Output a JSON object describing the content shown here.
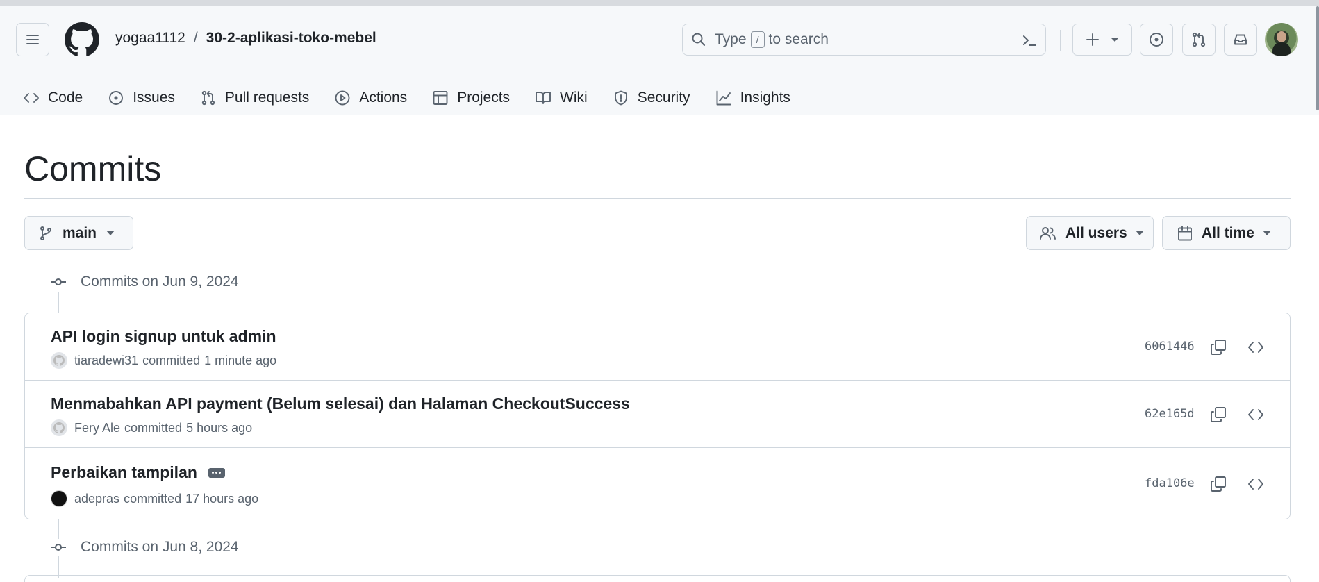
{
  "repo": {
    "owner": "yogaa1112",
    "separator": "/",
    "name": "30-2-aplikasi-toko-mebel"
  },
  "search": {
    "placeholder_prefix": "Type",
    "placeholder_key": "/",
    "placeholder_suffix": "to search"
  },
  "nav_tabs": [
    {
      "label": "Code",
      "icon": "code-icon"
    },
    {
      "label": "Issues",
      "icon": "issue-opened-icon"
    },
    {
      "label": "Pull requests",
      "icon": "git-pull-request-icon"
    },
    {
      "label": "Actions",
      "icon": "play-icon"
    },
    {
      "label": "Projects",
      "icon": "table-icon"
    },
    {
      "label": "Wiki",
      "icon": "book-icon"
    },
    {
      "label": "Security",
      "icon": "shield-icon"
    },
    {
      "label": "Insights",
      "icon": "graph-icon"
    }
  ],
  "page": {
    "title": "Commits"
  },
  "filters": {
    "branch": "main",
    "users": "All users",
    "time": "All time"
  },
  "groups": [
    {
      "heading": "Commits on Jun 9, 2024",
      "commits": [
        {
          "message": "API login signup untuk admin",
          "author": "tiaradewi31",
          "action": "committed",
          "time": "1 minute ago",
          "sha": "6061446",
          "has_ellipsis": false
        },
        {
          "message": "Menmabahkan API payment (Belum selesai) dan Halaman CheckoutSuccess",
          "author": "Fery Ale",
          "action": "committed",
          "time": "5 hours ago",
          "sha": "62e165d",
          "has_ellipsis": false
        },
        {
          "message": "Perbaikan tampilan",
          "author": "adepras",
          "action": "committed",
          "time": "17 hours ago",
          "sha": "fda106e",
          "has_ellipsis": true
        }
      ]
    },
    {
      "heading": "Commits on Jun 8, 2024",
      "commits": []
    }
  ]
}
